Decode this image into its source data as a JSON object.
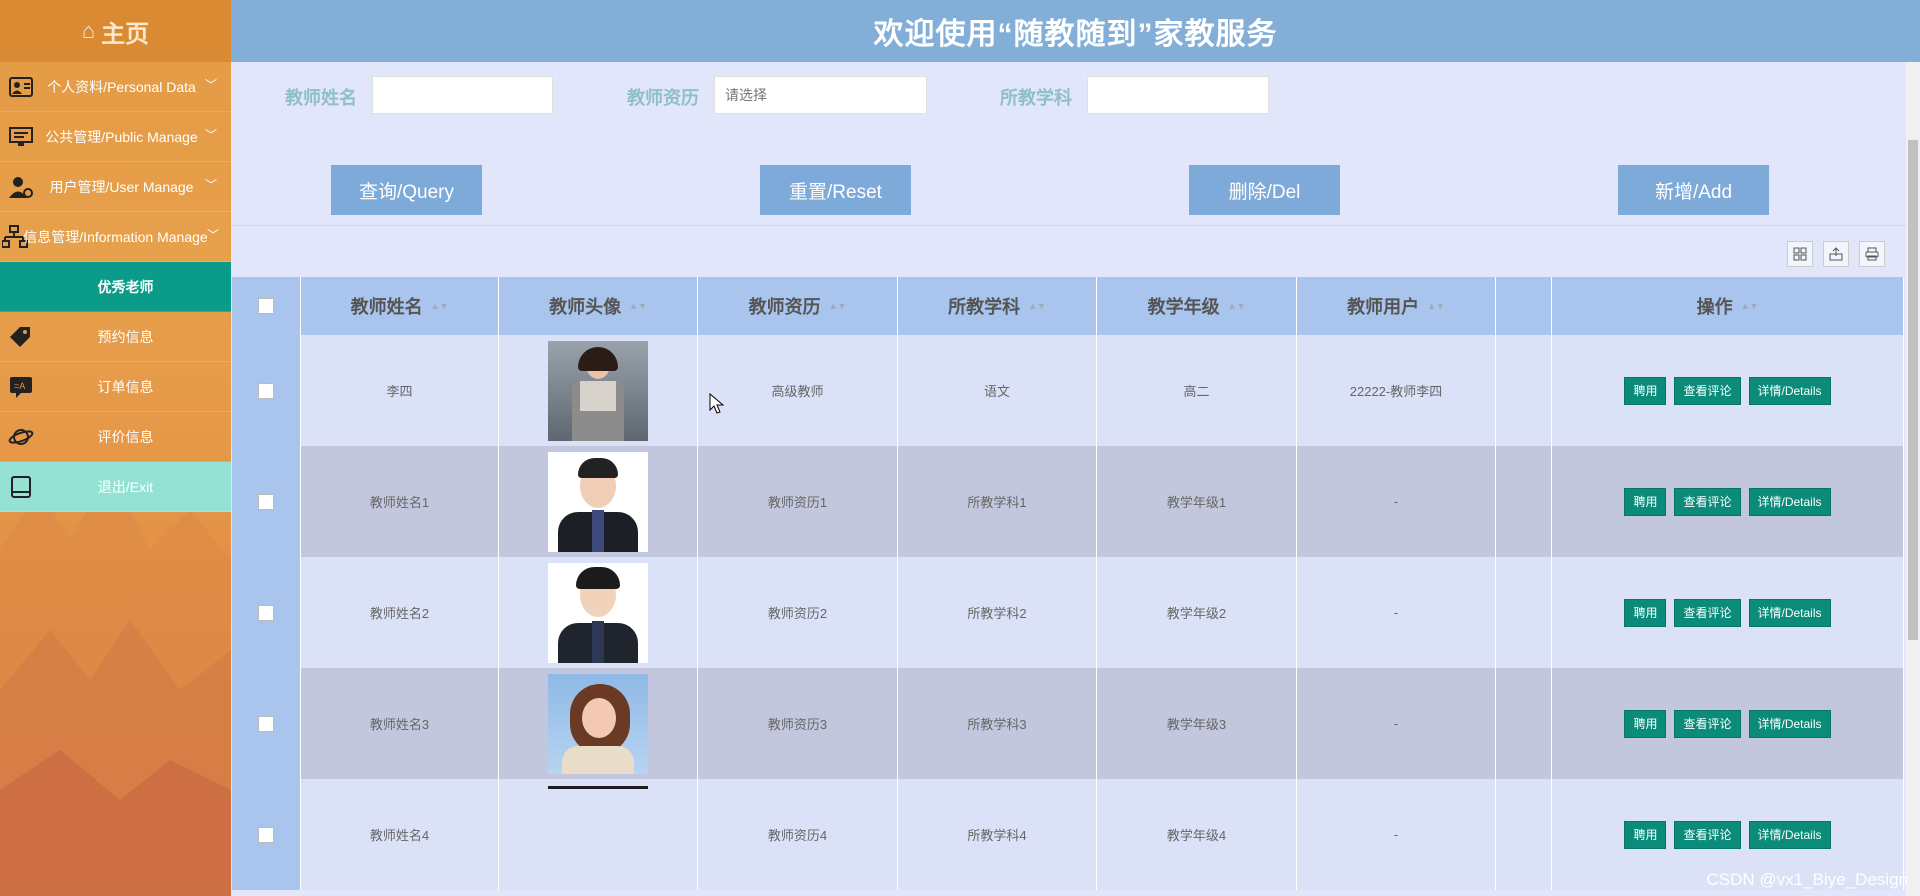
{
  "sidebar": {
    "home": "主页",
    "items": [
      {
        "label": "个人资料/Personal Data",
        "icon": "id-card-icon"
      },
      {
        "label": "公共管理/Public Manage",
        "icon": "monitor-icon"
      },
      {
        "label": "用户管理/User Manage",
        "icon": "user-gear-icon"
      },
      {
        "label": "信息管理/Information Manage",
        "icon": "sitemap-icon"
      }
    ],
    "subitems": [
      {
        "label": "优秀老师",
        "active": true
      },
      {
        "label": "预约信息",
        "icon": "tag-icon"
      },
      {
        "label": "订单信息",
        "icon": "translate-icon"
      },
      {
        "label": "评价信息",
        "icon": "planet-icon"
      },
      {
        "label": "退出/Exit",
        "icon": "book-icon"
      }
    ]
  },
  "header": {
    "title": "欢迎使用“随教随到”家教服务"
  },
  "search": {
    "name_label": "教师姓名",
    "edu_label": "教师资历",
    "edu_placeholder": "请选择",
    "subject_label": "所教学科",
    "buttons": {
      "query": "查询/Query",
      "reset": "重置/Reset",
      "delete": "删除/Del",
      "add": "新增/Add"
    }
  },
  "table": {
    "headers": [
      "教师姓名",
      "教师头像",
      "教师资历",
      "所教学科",
      "教学年级",
      "教师用户",
      "",
      "操作"
    ],
    "op_labels": {
      "hire": "聘用",
      "reviews": "查看评论",
      "details": "详情/Details"
    },
    "rows": [
      {
        "name": "李四",
        "edu": "高级教师",
        "subject": "语文",
        "grade": "高二",
        "user": "22222-教师李四"
      },
      {
        "name": "教师姓名1",
        "edu": "教师资历1",
        "subject": "所教学科1",
        "grade": "教学年级1",
        "user": "-"
      },
      {
        "name": "教师姓名2",
        "edu": "教师资历2",
        "subject": "所教学科2",
        "grade": "教学年级2",
        "user": "-"
      },
      {
        "name": "教师姓名3",
        "edu": "教师资历3",
        "subject": "所教学科3",
        "grade": "教学年级3",
        "user": "-"
      },
      {
        "name": "教师姓名4",
        "edu": "教师资历4",
        "subject": "所教学科4",
        "grade": "教学年级4",
        "user": "-"
      }
    ]
  },
  "watermark": "CSDN @vx1_Biye_Design",
  "colors": {
    "accent": "#0b8c7b",
    "header": "#82aed8",
    "button": "#7eaad9",
    "sidebar": "#e39a43"
  }
}
